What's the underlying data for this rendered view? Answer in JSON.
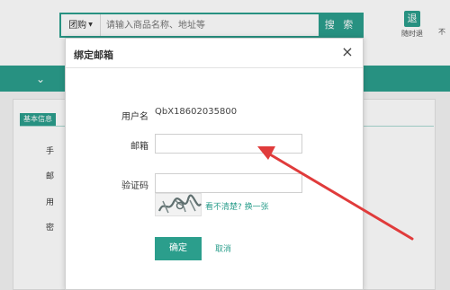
{
  "header": {
    "search_category": "团购",
    "search_placeholder": "请输入商品名称、地址等",
    "search_button": "搜 索",
    "link1_icon_char": "退",
    "link1_label": "随时退",
    "link2_label": "不"
  },
  "sidebar": {
    "basic_info_tag": "基本信息",
    "labels": [
      "手",
      "邮",
      "用",
      "密"
    ]
  },
  "modal": {
    "title": "绑定邮箱",
    "close_glyph": "×",
    "username_label": "用户名",
    "username_value": "QbX18602035800",
    "email_label": "邮箱",
    "email_value": "",
    "code_label": "验证码",
    "code_value": "",
    "captcha_link": "看不清楚? 换一张",
    "confirm_button": "确定",
    "cancel_link": "取消"
  },
  "colors": {
    "accent": "#2b9e8c",
    "annotation_arrow": "#e03b3b"
  }
}
